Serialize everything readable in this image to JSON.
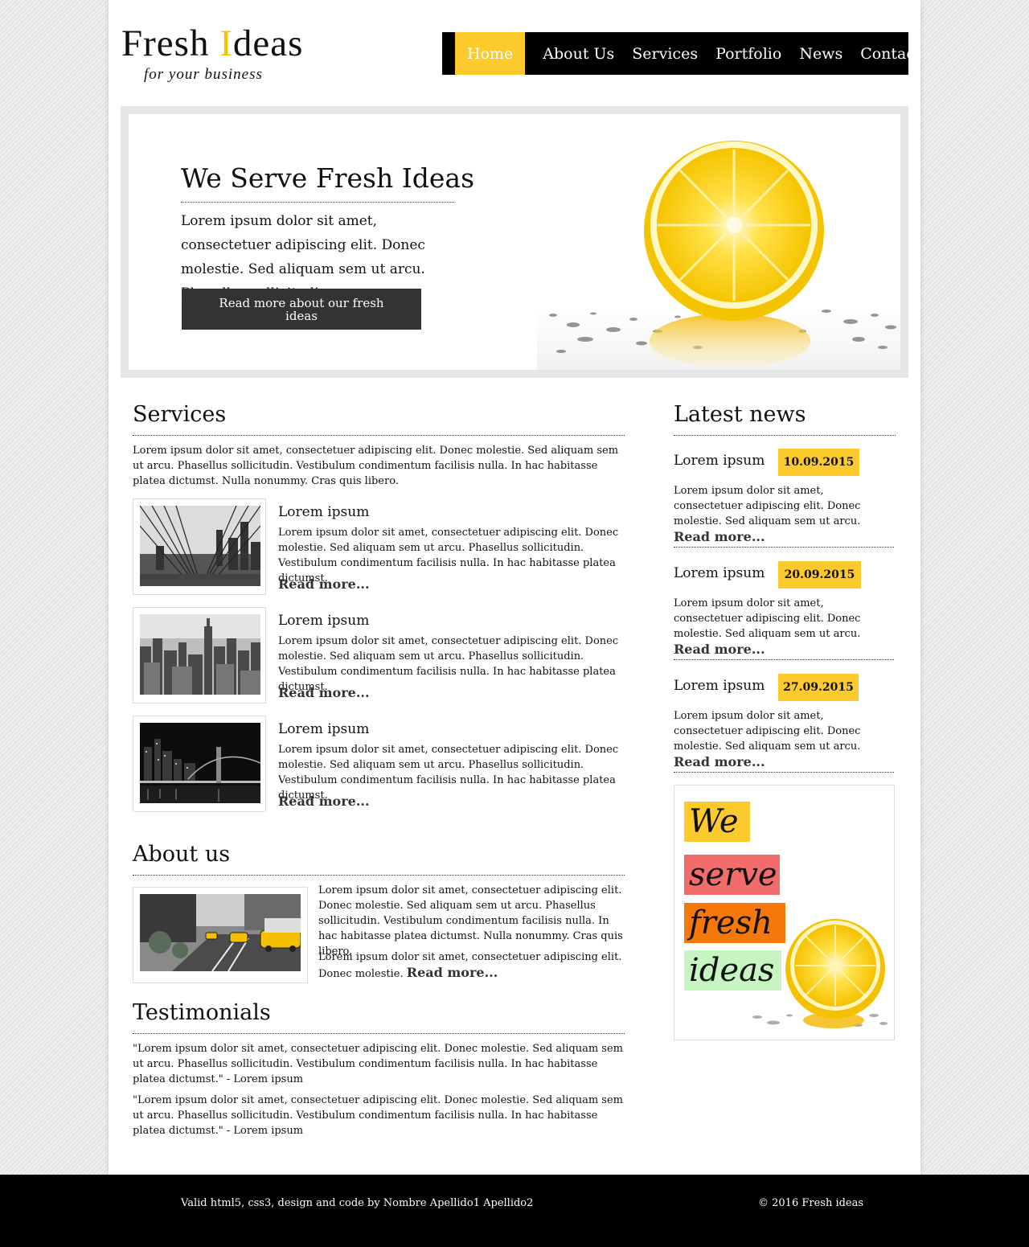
{
  "brand": {
    "logo_pre": "Fresh ",
    "logo_accent": "I",
    "logo_post": "deas",
    "tagline": "for your business",
    "accent_color": "#fdca2d"
  },
  "nav": {
    "items": [
      "Home",
      "About Us",
      "Services",
      "Portfolio",
      "News",
      "Contact"
    ],
    "active": "Home"
  },
  "hero": {
    "title": "We Serve Fresh Ideas",
    "text": "Lorem ipsum dolor sit amet, consectetuer adipiscing elit. Donec molestie. Sed aliquam sem ut arcu. Phasellus sollicitudin.",
    "button": "Read more about our fresh ideas",
    "image_icon": "lemon-image"
  },
  "services": {
    "heading": "Services",
    "intro": "Lorem ipsum dolor sit amet, consectetuer adipiscing elit. Donec molestie. Sed aliquam sem ut arcu. Phasellus sollicitudin. Vestibulum condimentum facilisis nulla. In hac habitasse platea dictumst. Nulla nonummy. Cras quis libero.",
    "items": [
      {
        "title": "Lorem ipsum",
        "text": "Lorem ipsum dolor sit amet, consectetuer adipiscing elit. Donec molestie. Sed aliquam sem ut arcu. Phasellus sollicitudin. Vestibulum condimentum facilisis nulla. In hac habitasse platea dictumst.",
        "link": "Read more...",
        "image_icon": "bridge-cables-photo"
      },
      {
        "title": "Lorem ipsum",
        "text": "Lorem ipsum dolor sit amet, consectetuer adipiscing elit. Donec molestie. Sed aliquam sem ut arcu. Phasellus sollicitudin. Vestibulum condimentum facilisis nulla. In hac habitasse platea dictumst.",
        "link": "Read more...",
        "image_icon": "city-skyline-photo"
      },
      {
        "title": "Lorem ipsum",
        "text": "Lorem ipsum dolor sit amet, consectetuer adipiscing elit. Donec molestie. Sed aliquam sem ut arcu. Phasellus sollicitudin. Vestibulum condimentum facilisis nulla. In hac habitasse platea dictumst.",
        "link": "Read more...",
        "image_icon": "night-bridge-photo"
      }
    ]
  },
  "about": {
    "heading": "About us",
    "text1": "Lorem ipsum dolor sit amet, consectetuer adipiscing elit. Donec molestie. Sed aliquam sem ut arcu. Phasellus sollicitudin. Vestibulum condimentum facilisis nulla. In hac habitasse platea dictumst. Nulla nonummy. Cras quis libero.",
    "text2": "Lorem ipsum dolor sit amet, consectetuer adipiscing elit. Donec molestie.",
    "link": "Read more...",
    "image_icon": "taxi-street-photo"
  },
  "testimonials": {
    "heading": "Testimonials",
    "items": [
      "\"Lorem ipsum dolor sit amet, consectetuer adipiscing elit. Donec molestie. Sed aliquam sem ut arcu. Phasellus sollicitudin. Vestibulum condimentum facilisis nulla. In hac habitasse platea dictumst.\" - Lorem ipsum",
      "\"Lorem ipsum dolor sit amet, consectetuer adipiscing elit. Donec molestie. Sed aliquam sem ut arcu. Phasellus sollicitudin. Vestibulum condimentum facilisis nulla. In hac habitasse platea dictumst.\" - Lorem ipsum"
    ]
  },
  "news": {
    "heading": "Latest news",
    "items": [
      {
        "title": "Lorem ipsum",
        "date": "10.09.2015",
        "text": "Lorem ipsum dolor sit amet, consectetuer adipiscing elit. Donec molestie. Sed aliquam sem ut arcu.",
        "link": "Read more..."
      },
      {
        "title": "Lorem ipsum",
        "date": "20.09.2015",
        "text": "Lorem ipsum dolor sit amet, consectetuer adipiscing elit. Donec molestie. Sed aliquam sem ut arcu.",
        "link": "Read more..."
      },
      {
        "title": "Lorem ipsum",
        "date": "27.09.2015",
        "text": "Lorem ipsum dolor sit amet, consectetuer adipiscing elit. Donec molestie. Sed aliquam sem ut arcu.",
        "link": "Read more..."
      }
    ]
  },
  "ad": {
    "words": [
      "We",
      "serve",
      "fresh",
      "ideas"
    ],
    "colors": [
      "#fdca2d",
      "#f36c6c",
      "#f7780a",
      "#c6f5c2"
    ]
  },
  "footer": {
    "left": "Valid html5, css3, design and code by Nombre Apellido1 Apellido2",
    "right": "© 2016 Fresh ideas"
  }
}
